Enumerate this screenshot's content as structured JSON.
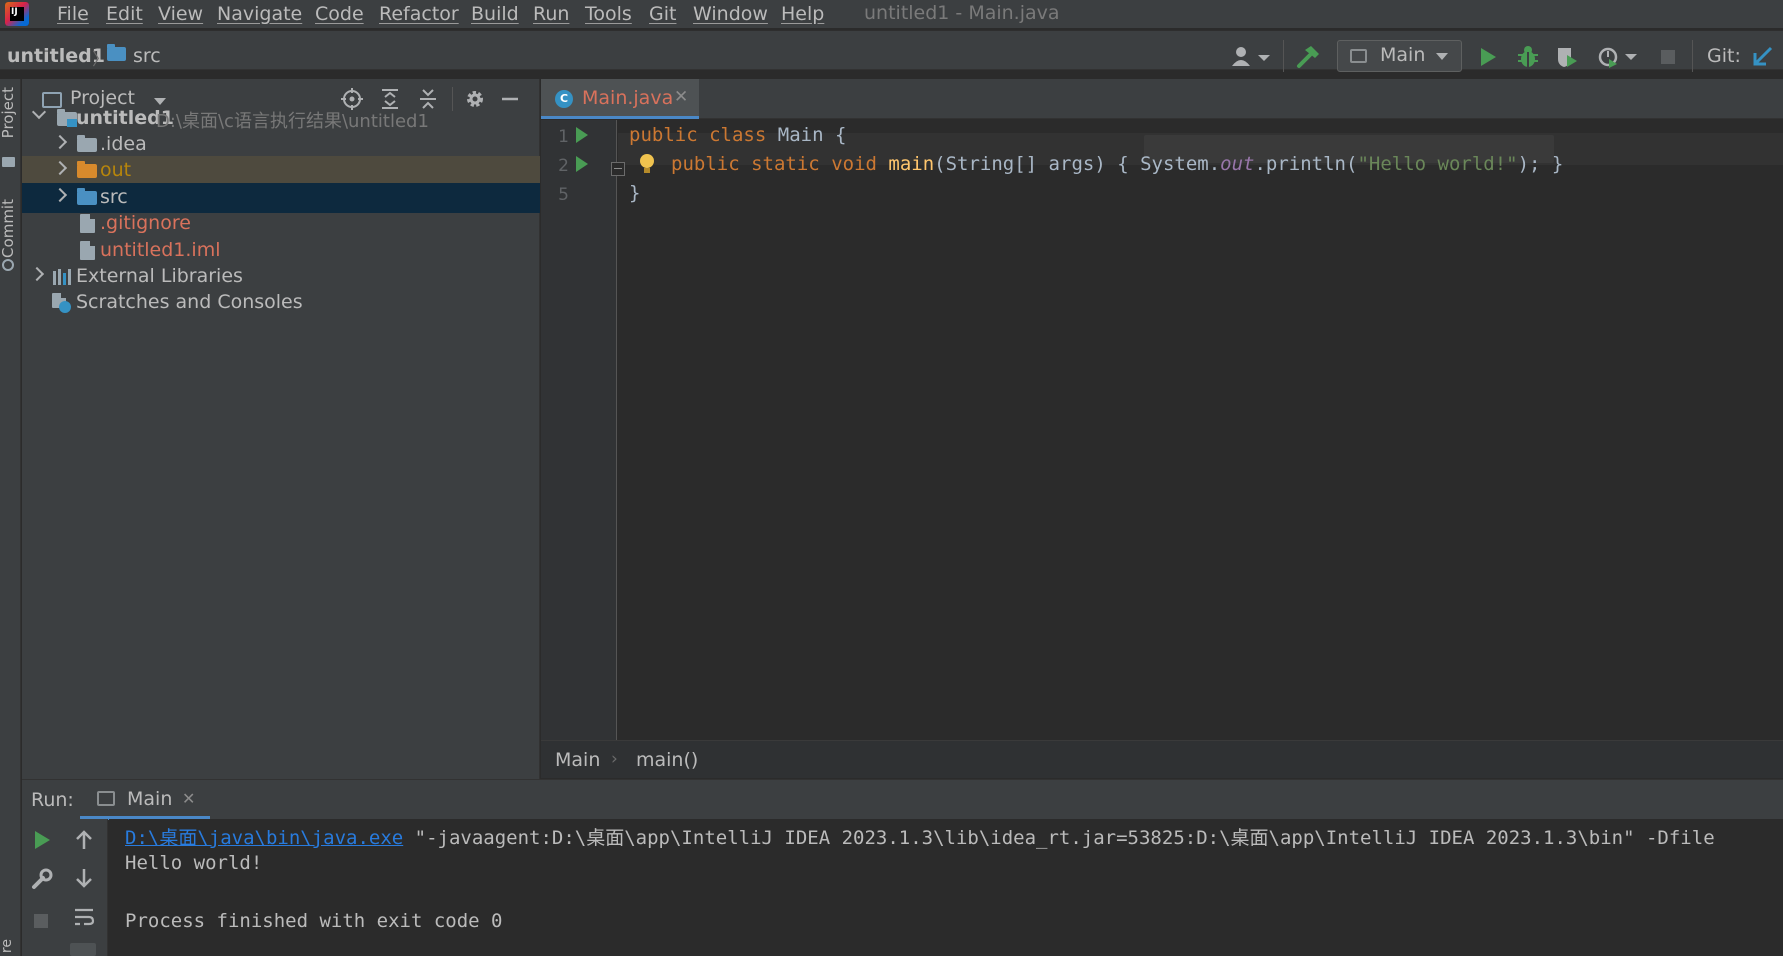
{
  "menubar": {
    "items": [
      "File",
      "Edit",
      "View",
      "Navigate",
      "Code",
      "Refactor",
      "Build",
      "Run",
      "Tools",
      "Git",
      "Window",
      "Help"
    ],
    "window_title": "untitled1 - Main.java"
  },
  "navbar": {
    "project": "untitled1",
    "folder": "src",
    "run_config": "Main",
    "git_label": "Git:"
  },
  "left_stripe": {
    "tabs": [
      "Project",
      "Commit"
    ]
  },
  "project_panel": {
    "title": "Project",
    "tree": [
      {
        "label": "untitled1",
        "path": "D:\\桌面\\c语言执行结果\\untitled1",
        "color": "#bbbbbb"
      },
      {
        "label": ".idea",
        "color": "#bbbbbb"
      },
      {
        "label": "out",
        "color": "#b8860b"
      },
      {
        "label": "src",
        "color": "#bbbbbb"
      },
      {
        "label": ".gitignore",
        "color": "#d9725c"
      },
      {
        "label": "untitled1.iml",
        "color": "#d9725c"
      },
      {
        "label": "External Libraries",
        "color": "#bbbbbb"
      },
      {
        "label": "Scratches and Consoles",
        "color": "#bbbbbb"
      }
    ]
  },
  "editor": {
    "tab_label": "Main.java",
    "line_numbers": [
      "1",
      "2",
      "5"
    ],
    "code": {
      "l1_kw1": "public",
      "l1_kw2": "class",
      "l1_rest": "Main {",
      "l2_kw1": "public",
      "l2_kw2": "static",
      "l2_kw3": "void",
      "l2_fn": "main",
      "l2_params": "(String[] args) { System.",
      "l2_out": "out",
      "l2_call": ".println(",
      "l2_str": "\"Hello world!\"",
      "l2_end": "); }",
      "l3": "}"
    },
    "breadcrumb": {
      "class": "Main",
      "method": "main()"
    }
  },
  "run_panel": {
    "label": "Run:",
    "tab_label": "Main",
    "console": {
      "java_exe": "D:\\桌面\\java\\bin\\java.exe",
      "cmd_rest": " \"-javaagent:D:\\桌面\\app\\IntelliJ IDEA 2023.1.3\\lib\\idea_rt.jar=53825:D:\\桌面\\app\\IntelliJ IDEA 2023.1.3\\bin\" -Dfile",
      "output": "Hello world!",
      "exit": "Process finished with exit code 0"
    }
  },
  "colors": {
    "accent": "#4a88c7",
    "run_green": "#499c54",
    "modified_file": "#d9725c"
  }
}
